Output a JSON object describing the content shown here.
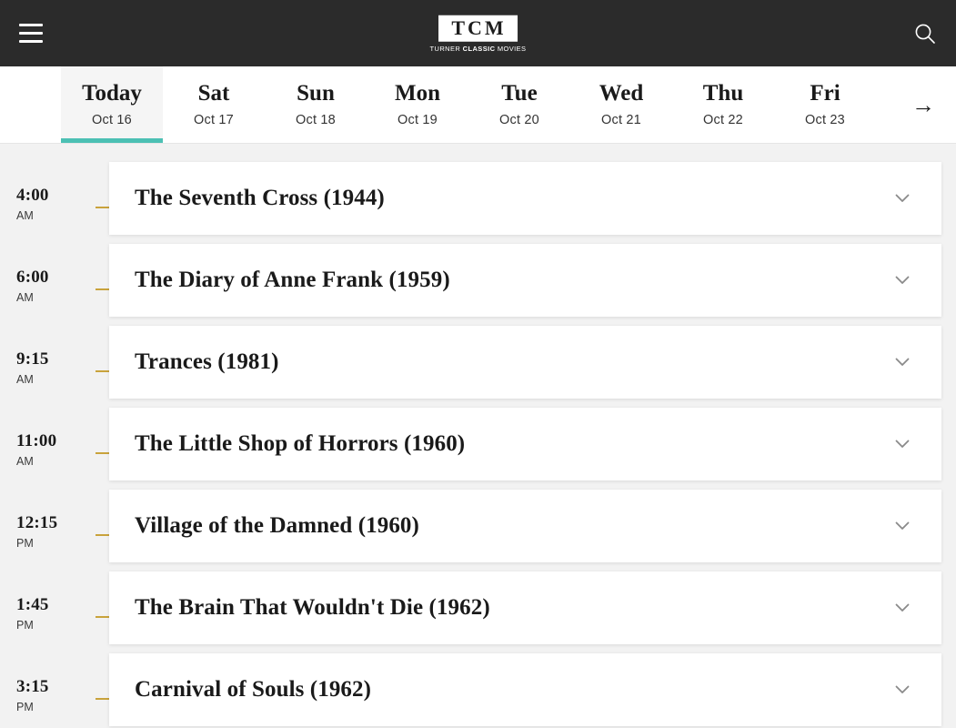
{
  "header": {
    "menu_icon": "hamburger-menu-icon",
    "logo_text": "TCM",
    "logo_tagline_1": "TURNER ",
    "logo_tagline_2": "CLASSIC",
    "logo_tagline_3": " MOVIES",
    "search_icon": "search-icon"
  },
  "date_tabs": {
    "next_arrow": "→",
    "items": [
      {
        "day": "Today",
        "date": "Oct 16",
        "active": true
      },
      {
        "day": "Sat",
        "date": "Oct 17",
        "active": false
      },
      {
        "day": "Sun",
        "date": "Oct 18",
        "active": false
      },
      {
        "day": "Mon",
        "date": "Oct 19",
        "active": false
      },
      {
        "day": "Tue",
        "date": "Oct 20",
        "active": false
      },
      {
        "day": "Wed",
        "date": "Oct 21",
        "active": false
      },
      {
        "day": "Thu",
        "date": "Oct 22",
        "active": false
      },
      {
        "day": "Fri",
        "date": "Oct 23",
        "active": false
      }
    ]
  },
  "schedule": {
    "expand_icon": "chevron-down-icon",
    "rows": [
      {
        "clock": "4:00",
        "meridiem": "AM",
        "title": "The Seventh Cross (1944)"
      },
      {
        "clock": "6:00",
        "meridiem": "AM",
        "title": "The Diary of Anne Frank (1959)"
      },
      {
        "clock": "9:15",
        "meridiem": "AM",
        "title": "Trances (1981)"
      },
      {
        "clock": "11:00",
        "meridiem": "AM",
        "title": "The Little Shop of Horrors (1960)"
      },
      {
        "clock": "12:15",
        "meridiem": "PM",
        "title": "Village of the Damned (1960)"
      },
      {
        "clock": "1:45",
        "meridiem": "PM",
        "title": "The Brain That Wouldn't Die (1962)"
      },
      {
        "clock": "3:15",
        "meridiem": "PM",
        "title": "Carnival of Souls (1962)"
      }
    ]
  },
  "colors": {
    "header_bg": "#2b2b2b",
    "active_tab_underline": "#4cc0b4",
    "connector_dash": "#c9a33c",
    "page_bg": "#f2f2f2",
    "card_bg": "#ffffff"
  }
}
